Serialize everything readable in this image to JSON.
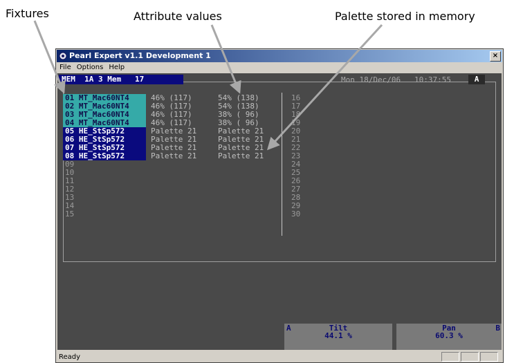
{
  "callouts": {
    "fixtures": "Fixtures",
    "attribute_values": "Attribute values",
    "palette": "Palette stored in memory"
  },
  "window": {
    "title": "Pearl Expert v1.1 Development 1",
    "close_label": "×",
    "icon": "pearl-app-icon"
  },
  "menu": {
    "items": [
      "File",
      "Options",
      "Help"
    ]
  },
  "screen": {
    "mem_bar": "MEM  1A 3 Mem   17",
    "datetime": "Mon 18/Dec/06   10:37:55",
    "selected": "A",
    "fixtures": [
      {
        "label": "01 MT_Mac60NT4",
        "type": "mac",
        "v1": "46% (117)",
        "v2": "54% (138)"
      },
      {
        "label": "02 MT_Mac60NT4",
        "type": "mac",
        "v1": "46% (117)",
        "v2": "54% (138)"
      },
      {
        "label": "03 MT_Mac60NT4",
        "type": "mac",
        "v1": "46% (117)",
        "v2": "38% ( 96)"
      },
      {
        "label": "04 MT_Mac60NT4",
        "type": "mac",
        "v1": "46% (117)",
        "v2": "38% ( 96)"
      },
      {
        "label": "05 HE_StSp572",
        "type": "st",
        "v1": "Palette 21",
        "v2": "Palette 21"
      },
      {
        "label": "06 HE_StSp572",
        "type": "st",
        "v1": "Palette 21",
        "v2": "Palette 21"
      },
      {
        "label": "07 HE_StSp572",
        "type": "st",
        "v1": "Palette 21",
        "v2": "Palette 21"
      },
      {
        "label": "08 HE_StSp572",
        "type": "st",
        "v1": "Palette 21",
        "v2": "Palette 21"
      },
      {
        "label": "09",
        "type": "empty",
        "v1": "",
        "v2": ""
      },
      {
        "label": "10",
        "type": "empty",
        "v1": "",
        "v2": ""
      },
      {
        "label": "11",
        "type": "empty",
        "v1": "",
        "v2": ""
      },
      {
        "label": "12",
        "type": "empty",
        "v1": "",
        "v2": ""
      },
      {
        "label": "13",
        "type": "empty",
        "v1": "",
        "v2": ""
      },
      {
        "label": "14",
        "type": "empty",
        "v1": "",
        "v2": ""
      },
      {
        "label": "15",
        "type": "empty",
        "v1": "",
        "v2": ""
      }
    ],
    "right_numbers": [
      "16",
      "17",
      "18",
      "19",
      "20",
      "21",
      "22",
      "23",
      "24",
      "25",
      "26",
      "27",
      "28",
      "29",
      "30"
    ]
  },
  "encoders": [
    {
      "letter": "A",
      "name": "Tilt",
      "value": "44.1 %"
    },
    {
      "letter": "B",
      "name": "Pan",
      "value": "60.3 %"
    }
  ],
  "status": {
    "text": "Ready"
  },
  "colors": {
    "screen_bg": "#494949",
    "mac_fixture_bg": "#35aaa8",
    "st_fixture_bg": "#0a0a7e",
    "titlebar_start": "#0a246a",
    "titlebar_end": "#a6caf0"
  }
}
